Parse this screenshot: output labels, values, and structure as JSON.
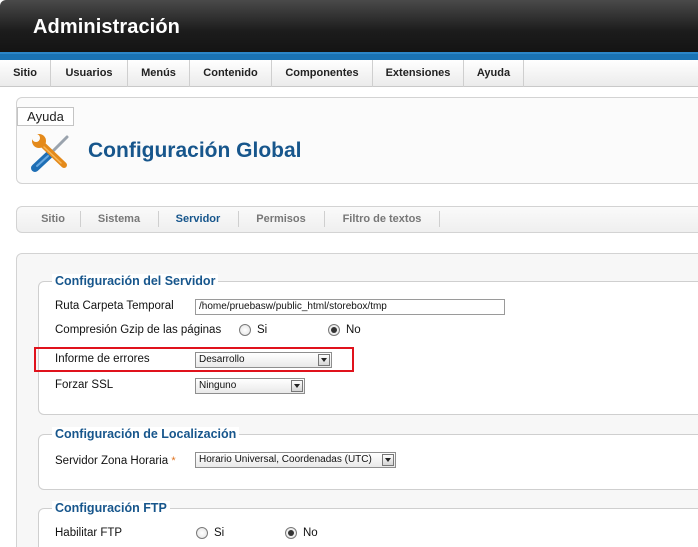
{
  "header": {
    "title": "Administración"
  },
  "menu": {
    "items": [
      "Sitio",
      "Usuarios",
      "Menús",
      "Contenido",
      "Componentes",
      "Extensiones",
      "Ayuda"
    ]
  },
  "toolbar": {
    "help_label": "Ayuda",
    "page_title": "Configuración Global"
  },
  "tabs": {
    "items": [
      "Sitio",
      "Sistema",
      "Servidor",
      "Permisos",
      "Filtro de textos"
    ],
    "active": "Servidor"
  },
  "server": {
    "legend": "Configuración del Servidor",
    "temp_path_label": "Ruta Carpeta Temporal",
    "temp_path_value": "/home/pruebasw/public_html/storebox/tmp",
    "gzip_label": "Compresión Gzip de las páginas",
    "gzip_yes": "Si",
    "gzip_no": "No",
    "error_label": "Informe de errores",
    "error_value": "Desarrollo",
    "ssl_label": "Forzar SSL",
    "ssl_value": "Ninguno"
  },
  "locale": {
    "legend": "Configuración de Localización",
    "timezone_label": "Servidor Zona Horaria",
    "required_mark": "*",
    "timezone_value": "Horario Universal, Coordenadas (UTC)"
  },
  "ftp": {
    "legend": "Configuración FTP",
    "enable_label": "Habilitar FTP",
    "yes": "Si",
    "no": "No"
  },
  "colors": {
    "accent": "#17568c",
    "header_blue": "#1a73b4",
    "highlight_red": "#e0121c"
  },
  "icons": {
    "tools": "wrench-screwdriver-icon"
  }
}
